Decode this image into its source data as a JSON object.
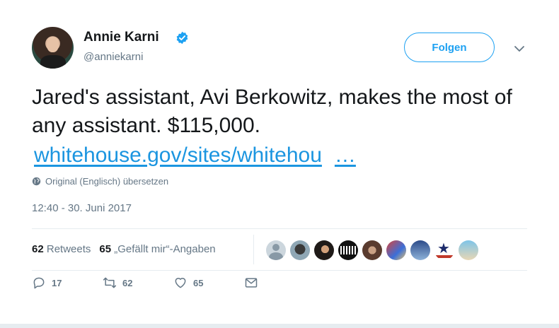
{
  "author": {
    "name": "Annie Karni",
    "handle": "@anniekarni",
    "verified_icon": "verified-badge-icon"
  },
  "header": {
    "follow_label": "Folgen",
    "more_icon": "chevron-down-icon"
  },
  "tweet": {
    "text": "Jared's assistant, Avi Berkowitz, makes the most of any assistant. $115,000.",
    "link": "whitehouse.gov/sites/whitehou",
    "link_ellipsis": "…",
    "translate": "Original (Englisch) übersetzen",
    "timestamp": "12:40 - 30. Juni 2017"
  },
  "stats": {
    "retweets_count": "62",
    "retweets_label": "Retweets",
    "likes_count": "65",
    "likes_label": "„Gefällt mir“-Angaben"
  },
  "likers": [
    "avatar-default",
    "avatar-user-2",
    "avatar-user-3",
    "avatar-resist",
    "avatar-user-5",
    "avatar-user-6",
    "avatar-user-7",
    "avatar-flag-star",
    "avatar-user-9"
  ],
  "actions": {
    "reply_count": "17",
    "retweet_count": "62",
    "like_count": "65"
  },
  "colors": {
    "accent": "#1da1f2",
    "link": "#1b95e0",
    "muted": "#657786",
    "text": "#14171a"
  }
}
